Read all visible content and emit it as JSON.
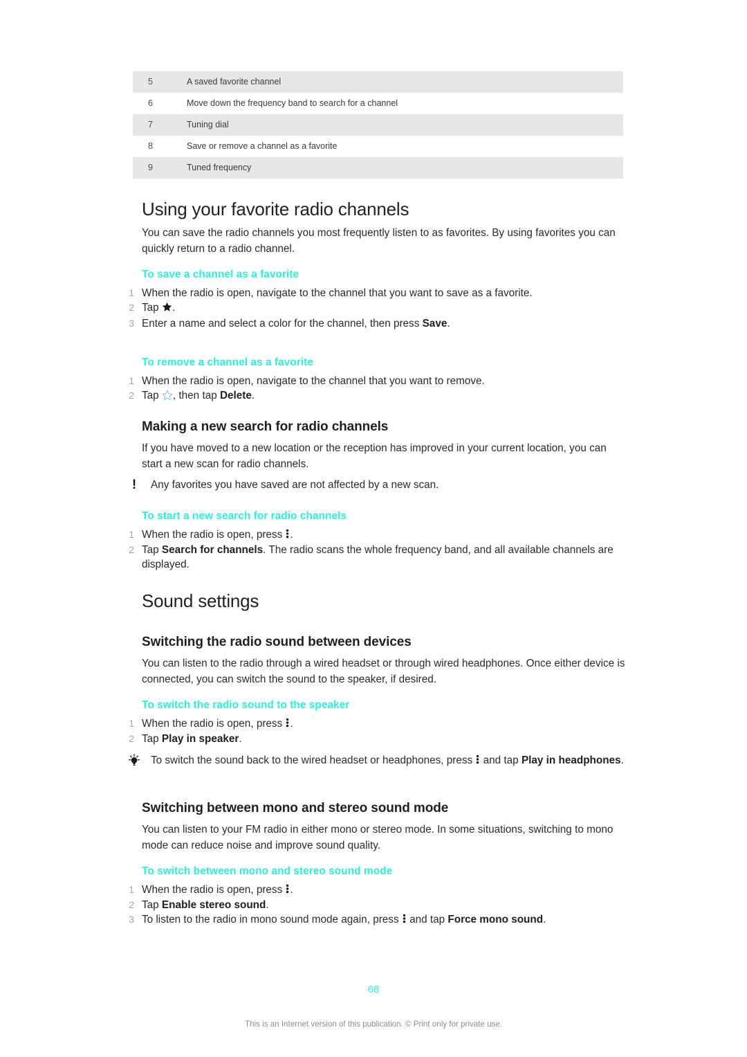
{
  "reference_table": {
    "rows": [
      {
        "num": "5",
        "desc": "A saved favorite channel",
        "shaded": true
      },
      {
        "num": "6",
        "desc": "Move down the frequency band to search for a channel",
        "shaded": false
      },
      {
        "num": "7",
        "desc": "Tuning dial",
        "shaded": true
      },
      {
        "num": "8",
        "desc": "Save or remove a channel as a favorite",
        "shaded": false
      },
      {
        "num": "9",
        "desc": "Tuned frequency",
        "shaded": true
      }
    ]
  },
  "sections": {
    "favorites": {
      "heading": "Using your favorite radio channels",
      "intro": "You can save the radio channels you most frequently listen to as favorites. By using favorites you can quickly return to a radio channel.",
      "save_task": {
        "heading": "To save a channel as a favorite",
        "steps": [
          {
            "num": "1",
            "text_before": "When the radio is open, navigate to the channel that you want to save as a favorite."
          },
          {
            "num": "2",
            "text_before": "Tap ",
            "icon": "star-filled-icon",
            "text_after": "."
          },
          {
            "num": "3",
            "text_before": "Enter a name and select a color for the channel, then press ",
            "bold": "Save",
            "text_after": "."
          }
        ]
      },
      "remove_task": {
        "heading": "To remove a channel as a favorite",
        "steps": [
          {
            "num": "1",
            "text_before": "When the radio is open, navigate to the channel that you want to remove."
          },
          {
            "num": "2",
            "text_before": "Tap ",
            "icon": "star-outline-icon",
            "text_mid": ", then tap ",
            "bold": "Delete",
            "text_after": "."
          }
        ]
      }
    },
    "new_search": {
      "heading": "Making a new search for radio channels",
      "intro": "If you have moved to a new location or the reception has improved in your current location, you can start a new scan for radio channels.",
      "note": {
        "icon": "exclamation-note-icon",
        "text": "Any favorites you have saved are not affected by a new scan."
      },
      "task": {
        "heading": "To start a new search for radio channels",
        "steps": [
          {
            "num": "1",
            "text_before": "When the radio is open, press ",
            "icon": "overflow-menu-icon",
            "text_after": "."
          },
          {
            "num": "2",
            "text_before": "Tap ",
            "bold": "Search for channels",
            "text_after": ". The radio scans the whole frequency band, and all available channels are displayed."
          }
        ]
      }
    },
    "sound_settings": {
      "heading": "Sound settings",
      "switching_devices": {
        "heading": "Switching the radio sound between devices",
        "intro": "You can listen to the radio through a wired headset or through wired headphones. Once either device is connected, you can switch the sound to the speaker, if desired.",
        "task": {
          "heading": "To switch the radio sound to the speaker",
          "steps": [
            {
              "num": "1",
              "text_before": "When the radio is open, press ",
              "icon": "overflow-menu-icon",
              "text_after": "."
            },
            {
              "num": "2",
              "text_before": "Tap ",
              "bold": "Play in speaker",
              "text_after": "."
            }
          ]
        },
        "tip": {
          "icon": "lightbulb-tip-icon",
          "text_before": "To switch the sound back to the wired headset or headphones, press ",
          "icon2": "overflow-menu-icon",
          "text_mid": " and tap ",
          "bold": "Play in headphones",
          "text_after": "."
        }
      },
      "mono_stereo": {
        "heading": "Switching between mono and stereo sound mode",
        "intro": "You can listen to your FM radio in either mono or stereo mode. In some situations, switching to mono mode can reduce noise and improve sound quality.",
        "task": {
          "heading": "To switch between mono and stereo sound mode",
          "steps": [
            {
              "num": "1",
              "text_before": "When the radio is open, press ",
              "icon": "overflow-menu-icon",
              "text_after": "."
            },
            {
              "num": "2",
              "text_before": "Tap ",
              "bold": "Enable stereo sound",
              "text_after": "."
            },
            {
              "num": "3",
              "text_before": "To listen to the radio in mono sound mode again, press ",
              "icon": "overflow-menu-icon",
              "text_mid": " and tap ",
              "bold": "Force mono sound",
              "text_after": "."
            }
          ]
        }
      }
    }
  },
  "footer": {
    "page_number": "68",
    "note": "This is an Internet version of this publication. © Print only for private use."
  },
  "colors": {
    "accent": "#2ff0d8",
    "table_shade": "#e7e7e7",
    "body_text": "#2b2b2b",
    "step_number": "#a6a6a6",
    "footer_text": "#8d8d8d"
  }
}
